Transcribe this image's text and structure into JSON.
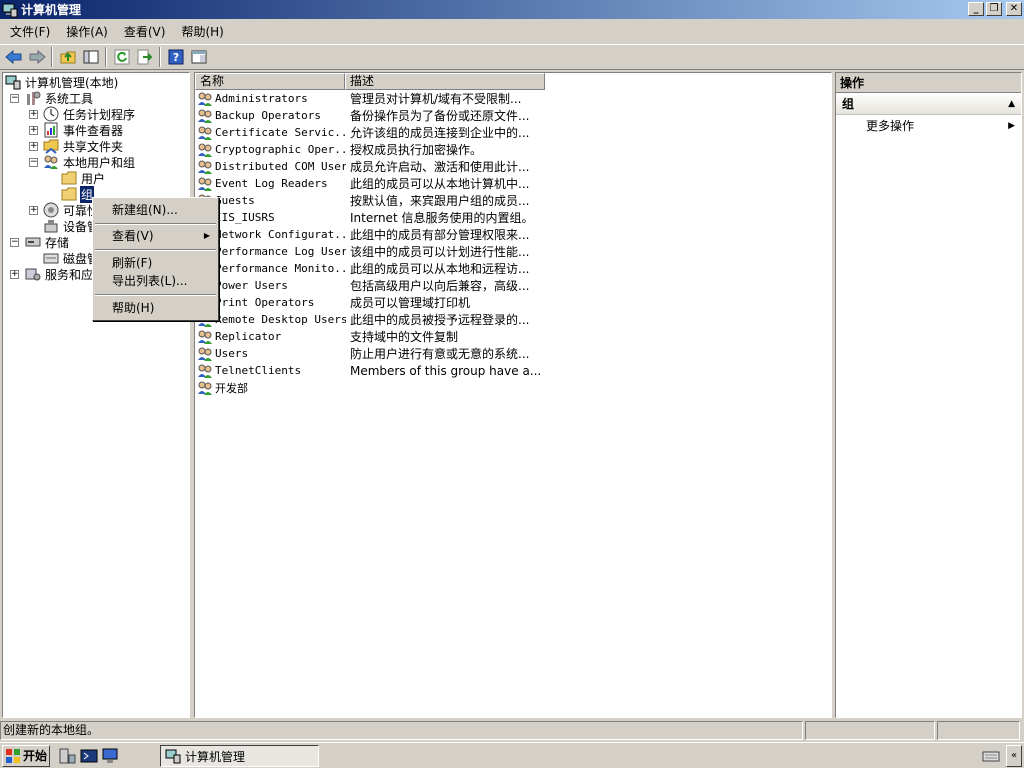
{
  "window": {
    "title": "计算机管理",
    "buttons": {
      "minimize": "_",
      "maximize": "❐",
      "close": "✕"
    }
  },
  "menu": [
    "文件(F)",
    "操作(A)",
    "查看(V)",
    "帮助(H)"
  ],
  "toolbar": [
    "back-icon",
    "forward-icon",
    "up-folder-icon",
    "show-hide-tree-icon",
    "refresh-icon",
    "export-list-icon",
    "help-icon",
    "properties-icon"
  ],
  "tree": {
    "root": "计算机管理(本地)",
    "system_tools": "系统工具",
    "task_scheduler": "任务计划程序",
    "event_viewer": "事件查看器",
    "shared_folders": "共享文件夹",
    "local_users_groups": "本地用户和组",
    "users": "用户",
    "groups": "组",
    "reliability": "可靠性",
    "device_manager": "设备管",
    "storage": "存储",
    "disk_mgmt": "磁盘管",
    "services_apps": "服务和应"
  },
  "list": {
    "columns": [
      "名称",
      "描述"
    ],
    "rows": [
      {
        "name": "Administrators",
        "desc": "管理员对计算机/域有不受限制..."
      },
      {
        "name": "Backup Operators",
        "desc": "备份操作员为了备份或还原文件..."
      },
      {
        "name": "Certificate Servic...",
        "desc": "允许该组的成员连接到企业中的..."
      },
      {
        "name": "Cryptographic Oper...",
        "desc": "授权成员执行加密操作。"
      },
      {
        "name": "Distributed COM Users",
        "desc": "成员允许启动、激活和使用此计..."
      },
      {
        "name": "Event Log Readers",
        "desc": "此组的成员可以从本地计算机中..."
      },
      {
        "name": "Guests",
        "desc": "按默认值，来宾跟用户组的成员..."
      },
      {
        "name": "IIS_IUSRS",
        "desc": "Internet 信息服务使用的内置组。"
      },
      {
        "name": "Network Configurat...",
        "desc": "此组中的成员有部分管理权限来..."
      },
      {
        "name": "Performance Log Users",
        "desc": "该组中的成员可以计划进行性能..."
      },
      {
        "name": "Performance Monito...",
        "desc": "此组的成员可以从本地和远程访..."
      },
      {
        "name": "Power Users",
        "desc": "包括高级用户以向后兼容，高级..."
      },
      {
        "name": "Print Operators",
        "desc": "成员可以管理域打印机"
      },
      {
        "name": "Remote Desktop Users",
        "desc": "此组中的成员被授予远程登录的..."
      },
      {
        "name": "Replicator",
        "desc": "支持域中的文件复制"
      },
      {
        "name": "Users",
        "desc": "防止用户进行有意或无意的系统..."
      },
      {
        "name": "TelnetClients",
        "desc": "Members of this group have a..."
      },
      {
        "name": "开发部",
        "desc": ""
      }
    ]
  },
  "actions": {
    "title": "操作",
    "group": "组",
    "more": "更多操作"
  },
  "context_menu": {
    "new_group": "新建组(N)...",
    "view": "查看(V)",
    "refresh": "刷新(F)",
    "export": "导出列表(L)...",
    "help": "帮助(H)"
  },
  "status": {
    "text": "创建新的本地组。"
  },
  "taskbar": {
    "start": "开始",
    "task": "计算机管理"
  },
  "colors": {
    "title_start": "#0a246a",
    "title_end": "#a6caf0",
    "selection": "#0a246a",
    "face": "#d4d0c8"
  }
}
